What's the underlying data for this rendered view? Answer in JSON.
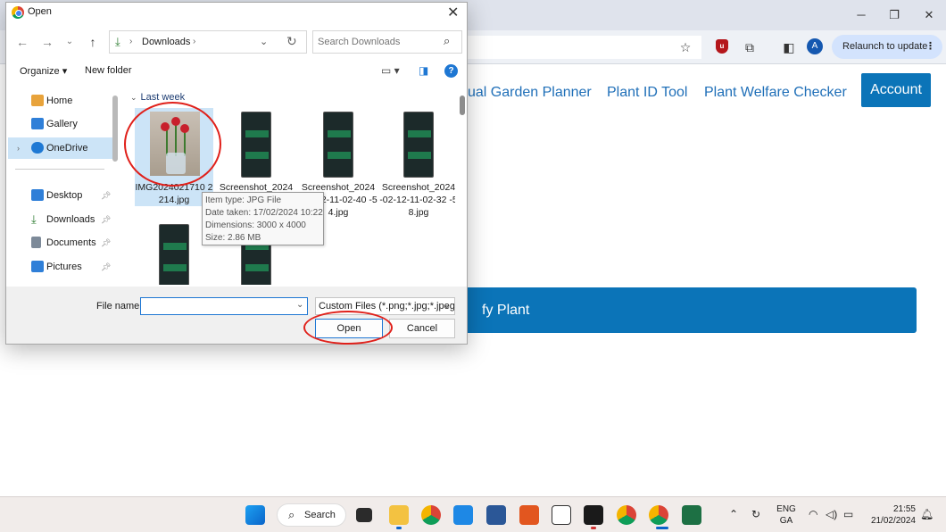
{
  "browser": {
    "relaunch_label": "Relaunch to update",
    "profile_initial": "A"
  },
  "site": {
    "nav": [
      "ual Garden Planner",
      "Plant ID Tool",
      "Plant Welfare Checker"
    ],
    "account_label": "Account",
    "identify_label": "fy Plant"
  },
  "dialog": {
    "title": "Open",
    "address_path": "Downloads",
    "search_placeholder": "Search Downloads",
    "organize_label": "Organize ▾",
    "new_folder_label": "New folder",
    "nav_items": [
      {
        "label": "Home",
        "icon": "home-icon",
        "color": "#e8a33b"
      },
      {
        "label": "Gallery",
        "icon": "gallery-icon",
        "color": "#2f7fd8"
      },
      {
        "label": "OneDrive",
        "icon": "onedrive-icon",
        "color": "#1f79d4"
      },
      {
        "label": "Desktop",
        "icon": "desktop-icon",
        "color": "#2f7fd8"
      },
      {
        "label": "Downloads",
        "icon": "downloads-icon",
        "color": "#2e7d32"
      },
      {
        "label": "Documents",
        "icon": "documents-icon",
        "color": "#7d8a99"
      },
      {
        "label": "Pictures",
        "icon": "pictures-icon",
        "color": "#2f7fd8"
      }
    ],
    "group_label": "Last week",
    "files": [
      {
        "name": "IMG2024021710 2214.jpg"
      },
      {
        "name": "Screenshot_2024"
      },
      {
        "name": "Screenshot_2024 -02-12-11-02-40 -54.jpg"
      },
      {
        "name": "Screenshot_2024 -02-12-11-02-32 -58.jpg"
      }
    ],
    "tooltip": {
      "type": "Item type: JPG File",
      "date": "Date taken: 17/02/2024 10:22",
      "dimensions": "Dimensions: 3000 x 4000",
      "size": "Size: 2.86 MB"
    },
    "file_name_label": "File name:",
    "file_name_value": "",
    "filter_label": "Custom Files (*.png;*.jpg;*.jpeg",
    "open_label": "Open",
    "cancel_label": "Cancel"
  },
  "taskbar": {
    "search_label": "Search",
    "lang_1": "ENG",
    "lang_2": "GA",
    "time": "21:55",
    "date": "21/02/2024"
  },
  "colors": {
    "accent": "#0b74b8",
    "annotation": "#e0201a"
  }
}
